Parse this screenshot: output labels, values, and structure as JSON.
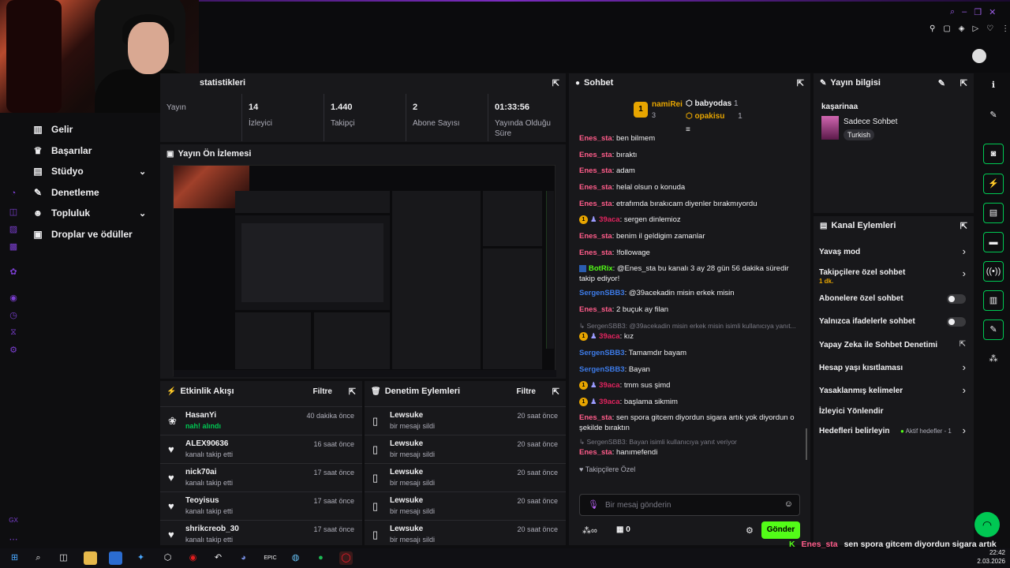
{
  "stats_panel": {
    "title": "statistikleri",
    "items": [
      {
        "value": "",
        "label": "Yayın"
      },
      {
        "value": "14",
        "label": "İzleyici"
      },
      {
        "value": "1.440",
        "label": "Takipçi"
      },
      {
        "value": "2",
        "label": "Abone Sayısı"
      },
      {
        "value": "01:33:56",
        "label": "Yayında Olduğu Süre"
      }
    ]
  },
  "left_nav": {
    "items": [
      {
        "label": "Gelir"
      },
      {
        "label": "Başarılar"
      },
      {
        "label": "Stüdyo"
      },
      {
        "label": "Denetleme"
      },
      {
        "label": "Topluluk"
      },
      {
        "label": "Droplar ve ödüller"
      }
    ],
    "rail_bottom": "GX"
  },
  "preview": {
    "title": "Yayın Ön İzlemesi"
  },
  "activity": {
    "title": "Etkinlik Akışı",
    "filter": "Filtre",
    "rows": [
      {
        "name": "HasanYi",
        "sub": "nah! alındı",
        "time": "40 dakika önce"
      },
      {
        "name": "ALEX90636",
        "sub": "kanalı takip etti",
        "time": "16 saat önce"
      },
      {
        "name": "nick70ai",
        "sub": "kanalı takip etti",
        "time": "17 saat önce"
      },
      {
        "name": "Teoyisus",
        "sub": "kanalı takip etti",
        "time": "17 saat önce"
      },
      {
        "name": "shrikcreob_30",
        "sub": "kanalı takip etti",
        "time": "17 saat önce"
      }
    ]
  },
  "moderation": {
    "title": "Denetim Eylemleri",
    "filter": "Filtre",
    "rows": [
      {
        "name": "Lewsuke",
        "sub": "bir mesajı sildi",
        "time": "20 saat önce"
      },
      {
        "name": "Lewsuke",
        "sub": "bir mesajı sildi",
        "time": "20 saat önce"
      },
      {
        "name": "Lewsuke",
        "sub": "bir mesajı sildi",
        "time": "20 saat önce"
      },
      {
        "name": "Lewsuke",
        "sub": "bir mesajı sildi",
        "time": "20 saat önce"
      },
      {
        "name": "Lewsuke",
        "sub": "bir mesajı sildi",
        "time": "20 saat önce"
      }
    ]
  },
  "chat": {
    "title": "Sohbet",
    "leaderboard": [
      {
        "name": "namiRei",
        "count": "3"
      },
      {
        "name": "babyodas",
        "count": "1"
      },
      {
        "name": "opakisu",
        "count": "1"
      }
    ],
    "messages": [
      {
        "user": "Enes_sta",
        "text": ": ben bilmem",
        "color": "#ff5c8a"
      },
      {
        "user": "Enes_sta",
        "text": ": bıraktı",
        "color": "#ff5c8a"
      },
      {
        "user": "Enes_sta",
        "text": ": adam",
        "color": "#ff5c8a"
      },
      {
        "user": "Enes_sta",
        "text": ": helal olsun o konuda",
        "color": "#ff5c8a"
      },
      {
        "user": "Enes_sta",
        "text": ": etrafımda bırakıcam diyenler bırakmıyordu",
        "color": "#ff5c8a"
      },
      {
        "user": "39aca",
        "text": ": sergen dinlemioz",
        "color": "#e0245e"
      },
      {
        "user": "Enes_sta",
        "text": ": benim il geldigim zamanlar",
        "color": "#ff5c8a"
      },
      {
        "user": "Enes_sta",
        "text": ": !followage",
        "color": "#ff5c8a"
      },
      {
        "user": "BotRix",
        "text": ": @Enes_sta bu kanalı 3 ay 28 gün 56 dakika süredir takip ediyor!",
        "color": "#53fc18"
      },
      {
        "user": "SergenSBB3",
        "text": ": @39acekadin misin erkek misin",
        "color": "#3d7be8"
      },
      {
        "user": "Enes_sta",
        "text": ": 2 buçuk ay filan",
        "color": "#ff5c8a"
      },
      {
        "user": "SergenSBB3: @39acekadin misin erkek misin isimli kullanıcıya yanıt...",
        "text": "",
        "color": "#7a7a85"
      },
      {
        "user": "39aca",
        "text": ": kız",
        "color": "#e0245e"
      },
      {
        "user": "SergenSBB3",
        "text": ": Tamamdır bayam",
        "color": "#3d7be8"
      },
      {
        "user": "SergenSBB3",
        "text": ": Bayan",
        "color": "#3d7be8"
      },
      {
        "user": "39aca",
        "text": ": tmm sus şimd",
        "color": "#e0245e"
      },
      {
        "user": "39aca",
        "text": ": başlama sikmim",
        "color": "#e0245e"
      },
      {
        "user": "Enes_sta",
        "text": ": sen spora gitcem diyordun sigara artık yok diyordun o şekilde bıraktın",
        "color": "#ff5c8a"
      },
      {
        "user": "SergenSBB3: Bayan isimli kullanıcıya yanıt veriyor",
        "text": "",
        "color": "#7a7a85"
      },
      {
        "user": "Enes_sta",
        "text": ": hanımefendi",
        "color": "#ff5c8a"
      }
    ],
    "followers_only": "Takipçilere Özel",
    "input_placeholder": "Bir mesaj gönderin",
    "points": "0",
    "send": "Gönder"
  },
  "stream_info": {
    "title": "Yayın bilgisi",
    "stream_title": "kaşarinaa",
    "category": "Sadece Sohbet",
    "language": "Turkish"
  },
  "channel_actions": {
    "title": "Kanal Eylemleri",
    "items": [
      {
        "label": "Yavaş mod",
        "extra": ""
      },
      {
        "label": "Takipçilere özel sohbet",
        "extra": "1 dk."
      },
      {
        "label": "Abonelere özel sohbet",
        "extra": ""
      },
      {
        "label": "Yalnızca ifadelerle sohbet",
        "extra": ""
      },
      {
        "label": "Yapay Zeka ile Sohbet Denetimi",
        "extra": ""
      },
      {
        "label": "Hesap yaşı kısıtlaması",
        "extra": ""
      },
      {
        "label": "Yasaklanmış kelimeler",
        "extra": ""
      },
      {
        "label": "İzleyici Yönlendir",
        "extra": ""
      },
      {
        "label": "Hedefleri belirleyin",
        "extra": "Aktif hedefler - 1"
      }
    ]
  },
  "overlay": {
    "user": "Enes_sta",
    "text": "sen spora gitcem diyordun sigara artık yok diyordun o şekilde bıraktın"
  },
  "taskbar": {
    "time": "22:42",
    "date": "2.03.2026"
  },
  "colors": {
    "accent": "#53fc18",
    "bg": "#0e0e10",
    "panel": "#18181b"
  }
}
